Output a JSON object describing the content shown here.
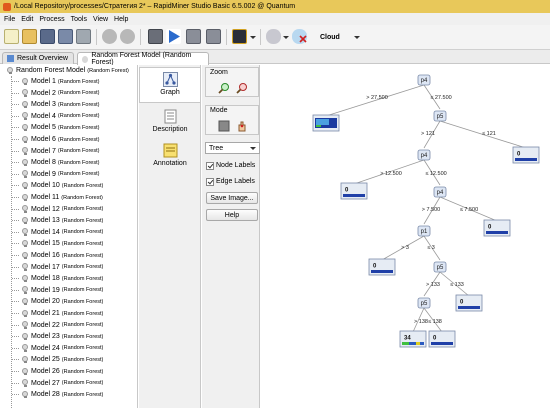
{
  "window": {
    "title": "/Local Repository/processes/Стратегия 2* – RapidMiner Studio Basic 6.5.002 @ Quantum"
  },
  "menu": [
    "File",
    "Edit",
    "Process",
    "Tools",
    "View",
    "Help"
  ],
  "toolbar": {
    "cloud_label": "Cloud"
  },
  "tabs": [
    {
      "label": "Result Overview"
    },
    {
      "label": "Random Forest Model (Random Forest)"
    }
  ],
  "tree": {
    "root": {
      "label": "Random Forest Model",
      "sub": "(Random Forest)"
    },
    "items": [
      {
        "label": "Model 1",
        "sub": "(Random Forest)"
      },
      {
        "label": "Model 2",
        "sub": "(Random Forest)"
      },
      {
        "label": "Model 3",
        "sub": "(Random Forest)"
      },
      {
        "label": "Model 4",
        "sub": "(Random Forest)"
      },
      {
        "label": "Model 5",
        "sub": "(Random Forest)"
      },
      {
        "label": "Model 6",
        "sub": "(Random Forest)"
      },
      {
        "label": "Model 7",
        "sub": "(Random Forest)"
      },
      {
        "label": "Model 8",
        "sub": "(Random Forest)"
      },
      {
        "label": "Model 9",
        "sub": "(Random Forest)"
      },
      {
        "label": "Model 10",
        "sub": "(Random Forest)"
      },
      {
        "label": "Model 11",
        "sub": "(Random Forest)"
      },
      {
        "label": "Model 12",
        "sub": "(Random Forest)"
      },
      {
        "label": "Model 13",
        "sub": "(Random Forest)"
      },
      {
        "label": "Model 14",
        "sub": "(Random Forest)"
      },
      {
        "label": "Model 15",
        "sub": "(Random Forest)"
      },
      {
        "label": "Model 16",
        "sub": "(Random Forest)"
      },
      {
        "label": "Model 17",
        "sub": "(Random Forest)"
      },
      {
        "label": "Model 18",
        "sub": "(Random Forest)"
      },
      {
        "label": "Model 19",
        "sub": "(Random Forest)"
      },
      {
        "label": "Model 20",
        "sub": "(Random Forest)"
      },
      {
        "label": "Model 21",
        "sub": "(Random Forest)"
      },
      {
        "label": "Model 22",
        "sub": "(Random Forest)"
      },
      {
        "label": "Model 23",
        "sub": "(Random Forest)"
      },
      {
        "label": "Model 24",
        "sub": "(Random Forest)"
      },
      {
        "label": "Model 25",
        "sub": "(Random Forest)"
      },
      {
        "label": "Model 26",
        "sub": "(Random Forest)"
      },
      {
        "label": "Model 27",
        "sub": "(Random Forest)"
      },
      {
        "label": "Model 28",
        "sub": "(Random Forest)"
      }
    ]
  },
  "views": [
    {
      "label": "Graph",
      "icon": "graph-icon"
    },
    {
      "label": "Description",
      "icon": "description-icon"
    },
    {
      "label": "Annotation",
      "icon": "annotation-icon"
    }
  ],
  "controls": {
    "zoom_title": "Zoom",
    "mode_title": "Mode",
    "layout_select": "Tree",
    "node_labels": "Node Labels",
    "edge_labels": "Edge Labels",
    "save_image": "Save Image...",
    "help": "Help"
  },
  "decision_tree": {
    "nodes": [
      {
        "id": "n1",
        "label": "p4"
      },
      {
        "id": "n2",
        "label": "p5"
      },
      {
        "id": "n3",
        "label": "p4"
      },
      {
        "id": "n4",
        "label": "p4"
      },
      {
        "id": "n5",
        "label": "p1"
      },
      {
        "id": "n6",
        "label": "p5"
      },
      {
        "id": "n7",
        "label": "p5"
      }
    ],
    "leaves": [
      {
        "id": "l1",
        "count": ""
      },
      {
        "id": "l2",
        "count": "0"
      },
      {
        "id": "l3",
        "count": "0"
      },
      {
        "id": "l4",
        "count": "0"
      },
      {
        "id": "l5",
        "count": "0"
      },
      {
        "id": "l6",
        "count": "0"
      },
      {
        "id": "l7",
        "count": "34"
      },
      {
        "id": "l8",
        "count": "0"
      }
    ],
    "edges": [
      {
        "from": "n1",
        "to": "l1",
        "label": "> 27.500"
      },
      {
        "from": "n1",
        "to": "n2",
        "label": "≤ 27.500"
      },
      {
        "from": "n2",
        "to": "n3",
        "label": "> 121"
      },
      {
        "from": "n2",
        "to": "l2",
        "label": "≤ 121"
      },
      {
        "from": "n3",
        "to": "l3",
        "label": "> 12.500"
      },
      {
        "from": "n3",
        "to": "n4",
        "label": "≤ 12.500"
      },
      {
        "from": "n4",
        "to": "n5",
        "label": "> 7.500"
      },
      {
        "from": "n4",
        "to": "l4",
        "label": "≤ 7.500"
      },
      {
        "from": "n5",
        "to": "l5",
        "label": "> 3"
      },
      {
        "from": "n5",
        "to": "n6",
        "label": "≤ 3"
      },
      {
        "from": "n6",
        "to": "n7",
        "label": "> 133"
      },
      {
        "from": "n6",
        "to": "l6",
        "label": "≤ 133"
      },
      {
        "from": "n7",
        "to": "l7",
        "label": "> 138"
      },
      {
        "from": "n7",
        "to": "l8",
        "label": "≤ 138"
      }
    ]
  }
}
